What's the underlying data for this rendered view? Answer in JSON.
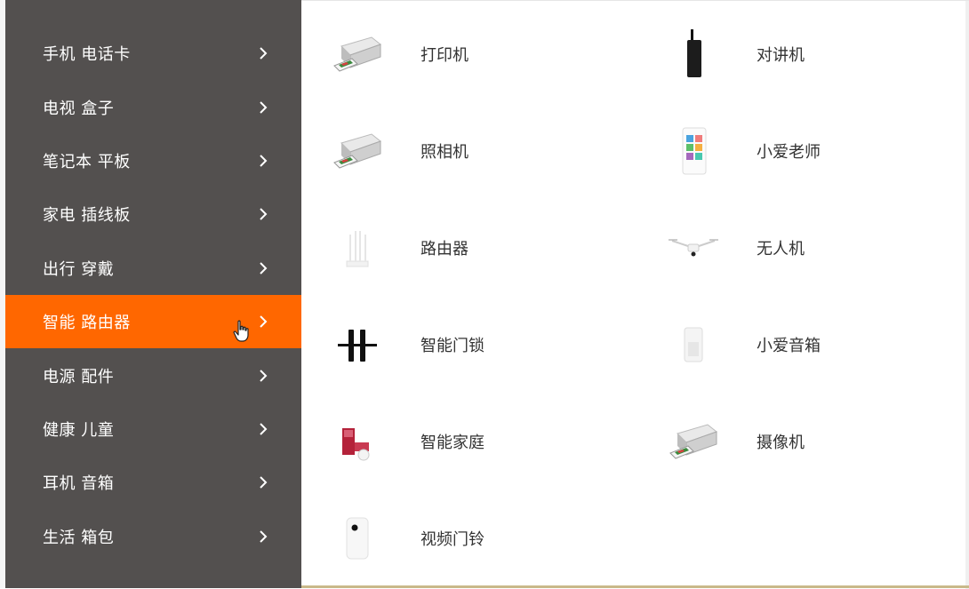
{
  "sidebar": {
    "items": [
      {
        "label": "手机 电话卡",
        "active": false
      },
      {
        "label": "电视 盒子",
        "active": false
      },
      {
        "label": "笔记本 平板",
        "active": false
      },
      {
        "label": "家电 插线板",
        "active": false
      },
      {
        "label": "出行 穿戴",
        "active": false
      },
      {
        "label": "智能 路由器",
        "active": true
      },
      {
        "label": "电源 配件",
        "active": false
      },
      {
        "label": "健康 儿童",
        "active": false
      },
      {
        "label": "耳机 音箱",
        "active": false
      },
      {
        "label": "生活 箱包",
        "active": false
      }
    ]
  },
  "products": {
    "col1": [
      {
        "name": "打印机",
        "icon": "printer-icon"
      },
      {
        "name": "照相机",
        "icon": "printer-icon"
      },
      {
        "name": "路由器",
        "icon": "router-icon"
      },
      {
        "name": "智能门锁",
        "icon": "door-lock-icon"
      },
      {
        "name": "智能家庭",
        "icon": "smart-home-icon"
      },
      {
        "name": "视频门铃",
        "icon": "doorbell-icon"
      }
    ],
    "col2": [
      {
        "name": "对讲机",
        "icon": "walkie-talkie-icon"
      },
      {
        "name": "小爱老师",
        "icon": "tablet-icon"
      },
      {
        "name": "无人机",
        "icon": "drone-icon"
      },
      {
        "name": "小爱音箱",
        "icon": "speaker-icon"
      },
      {
        "name": "摄像机",
        "icon": "printer-icon"
      }
    ]
  },
  "colors": {
    "sidebar_bg": "#53504f",
    "active_bg": "#ff6700",
    "text_light": "#ffffff",
    "text_dark": "#333333"
  }
}
